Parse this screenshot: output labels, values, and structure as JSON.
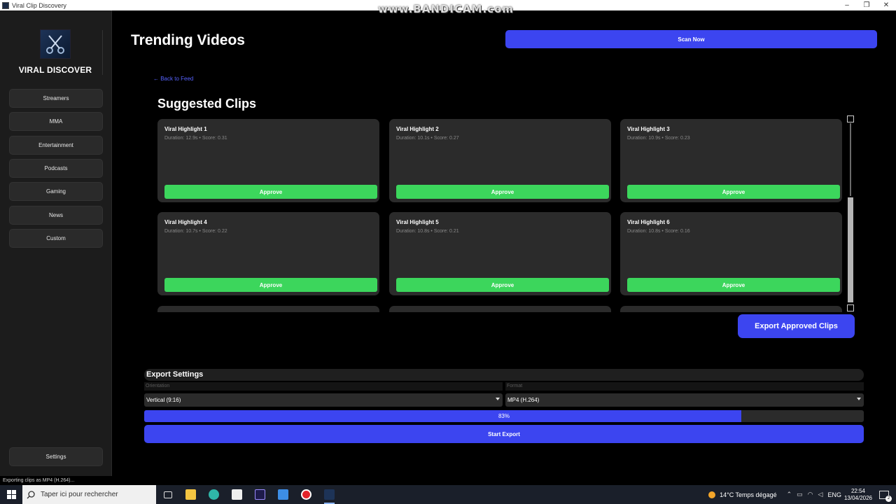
{
  "window": {
    "title": "Viral Clip Discovery",
    "watermark": "www.BANDICAM.com"
  },
  "sidebar": {
    "brand": "VIRAL DISCOVER",
    "items": [
      {
        "label": "Streamers"
      },
      {
        "label": "MMA"
      },
      {
        "label": "Entertainment"
      },
      {
        "label": "Podcasts"
      },
      {
        "label": "Gaming"
      },
      {
        "label": "News"
      },
      {
        "label": "Custom"
      }
    ],
    "settings_label": "Settings"
  },
  "header": {
    "title": "Trending Videos",
    "scan_label": "Scan Now"
  },
  "main": {
    "back_link": "← Back to Feed",
    "section_title": "Suggested Clips",
    "approve_label": "Approve",
    "clips": [
      {
        "title": "Viral Highlight 1",
        "meta": "Duration: 12.9s • Score: 0.31"
      },
      {
        "title": "Viral Highlight 2",
        "meta": "Duration: 10.1s • Score: 0.27"
      },
      {
        "title": "Viral Highlight 3",
        "meta": "Duration: 10.9s • Score: 0.23"
      },
      {
        "title": "Viral Highlight 4",
        "meta": "Duration: 10.7s • Score: 0.22"
      },
      {
        "title": "Viral Highlight 5",
        "meta": "Duration: 10.8s • Score: 0.21"
      },
      {
        "title": "Viral Highlight 6",
        "meta": "Duration: 10.8s • Score: 0.16"
      }
    ],
    "export_approved_label": "Export Approved Clips"
  },
  "export": {
    "title": "Export Settings",
    "orientation_label": "Orientation",
    "format_label": "Format",
    "orientation_value": "Vertical (9:16)",
    "format_value": "MP4 (H.264)",
    "progress_percent": 83,
    "progress_text": "83%",
    "start_label": "Start Export"
  },
  "status_bar": {
    "text": "Exporting clips as MP4 (H.264)..."
  },
  "taskbar": {
    "search_placeholder": "Taper ici pour rechercher",
    "weather": "14°C  Temps dégagé",
    "lang": "ENG",
    "time": "22:54",
    "date": "13/04/2026",
    "notification_count": "2"
  },
  "colors": {
    "accent": "#3c45f0",
    "approve": "#3cd65c",
    "card": "#2b2b2b",
    "sidebar": "#1c1c1c"
  }
}
